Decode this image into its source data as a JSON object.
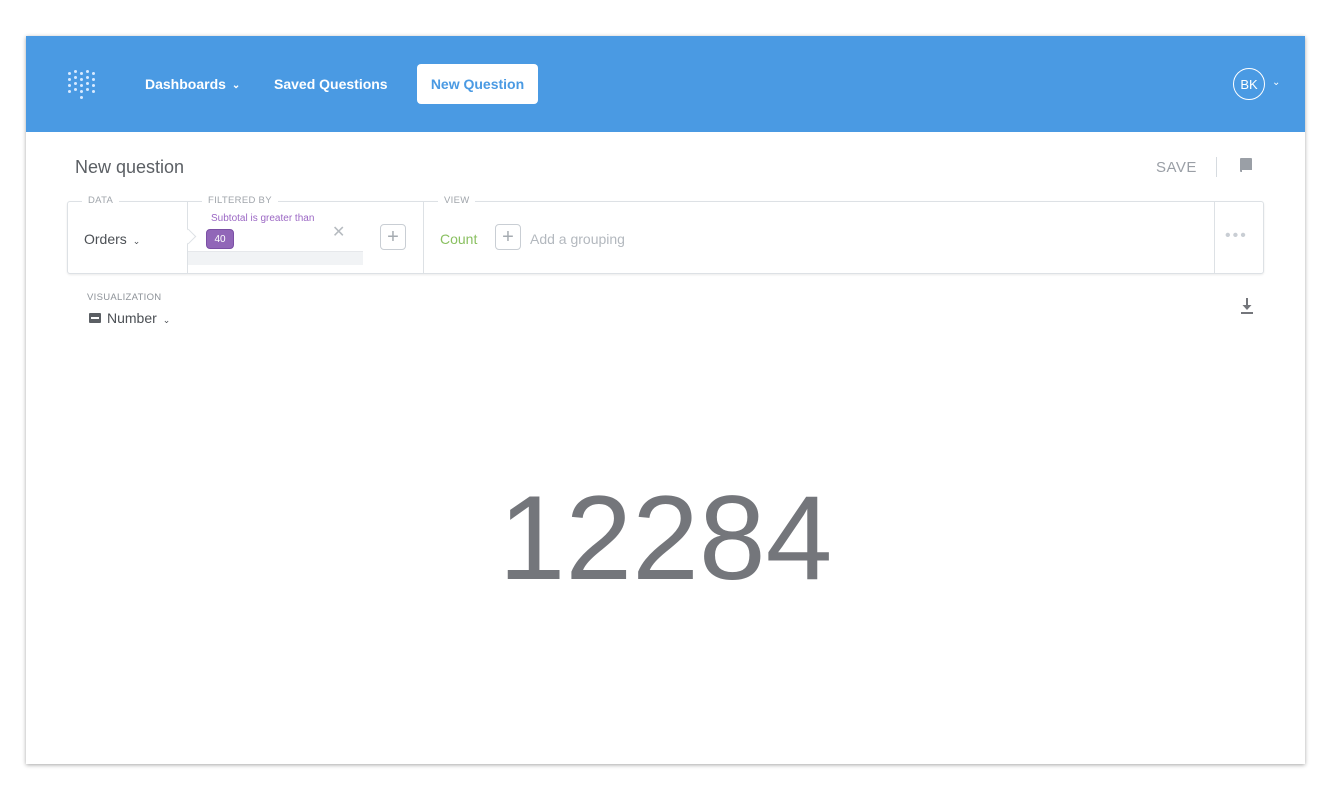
{
  "nav": {
    "dashboards_label": "Dashboards",
    "saved_questions_label": "Saved Questions",
    "new_question_label": "New Question",
    "avatar_initials": "BK"
  },
  "header": {
    "title": "New question",
    "save_label": "SAVE"
  },
  "query_builder": {
    "data_label": "DATA",
    "data_value": "Orders",
    "filtered_by_label": "FILTERED BY",
    "filter": {
      "description": "Subtotal is greater than",
      "value": "40"
    },
    "view_label": "VIEW",
    "aggregation": "Count",
    "grouping_placeholder": "Add a grouping"
  },
  "visualization": {
    "label": "VISUALIZATION",
    "type": "Number"
  },
  "result": {
    "value": "12284"
  },
  "colors": {
    "topbar": "#4a9ae3",
    "filter": "#9166b8",
    "aggregation": "#8ac061",
    "result_text": "#74767b"
  },
  "icons": {
    "logo": "metabase-logo-icon",
    "book": "book-icon",
    "download": "download-icon",
    "number_viz": "number-viz-icon"
  }
}
